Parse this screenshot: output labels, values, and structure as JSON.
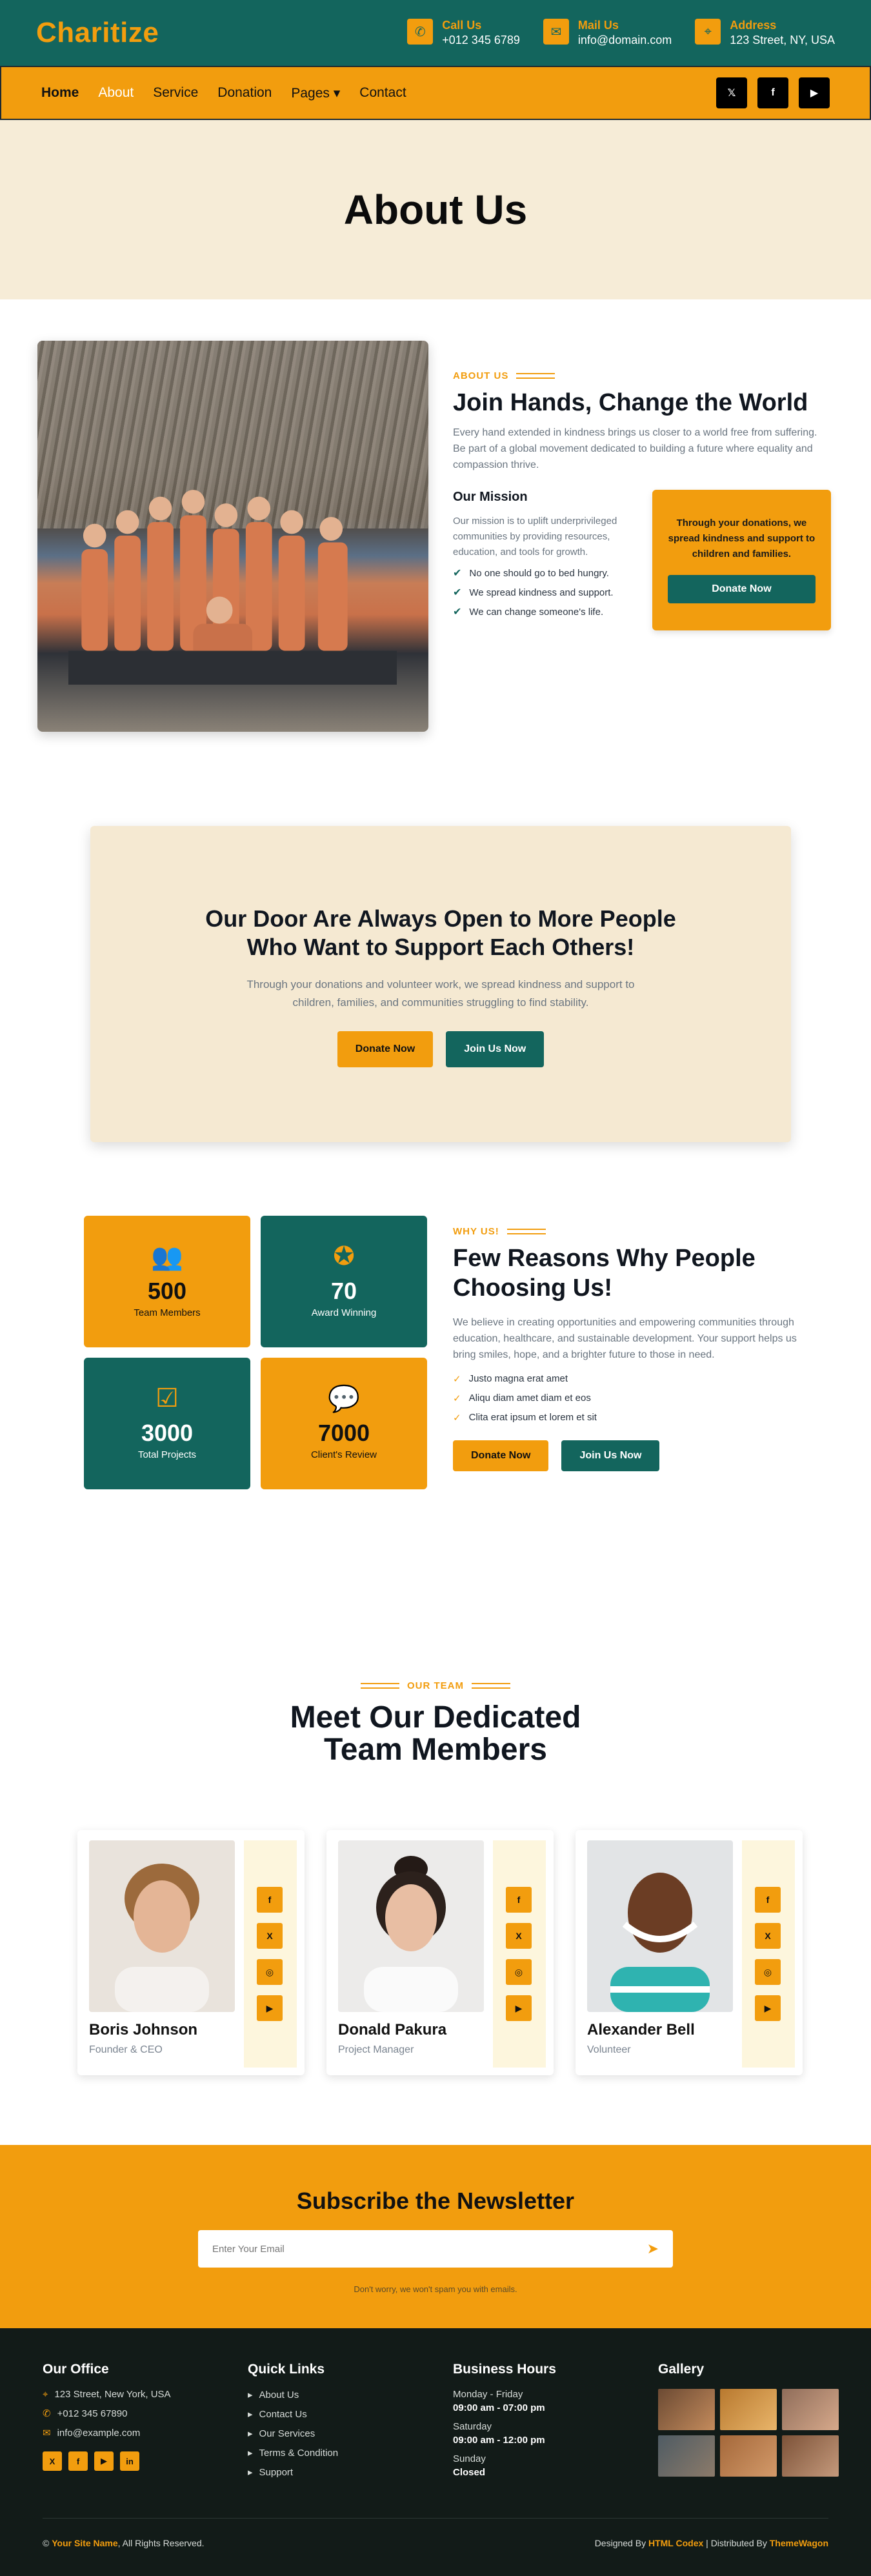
{
  "brand": {
    "logo": "Charitize"
  },
  "topbar": {
    "contacts": [
      {
        "label": "Call Us",
        "value": "+012 345 6789",
        "icon": "phone-icon"
      },
      {
        "label": "Mail Us",
        "value": "info@domain.com",
        "icon": "envelope-icon"
      },
      {
        "label": "Address",
        "value": "123 Street, NY, USA",
        "icon": "map-pin-icon"
      }
    ]
  },
  "nav": {
    "items": [
      "Home",
      "About",
      "Service",
      "Donation",
      "Pages",
      "Contact"
    ],
    "pages_caret": "▾",
    "social": [
      "twitter-icon",
      "facebook-icon",
      "youtube-icon"
    ]
  },
  "page_header": {
    "title": "About Us"
  },
  "about": {
    "eyebrow": "ABOUT US",
    "title": "Join Hands, Change the World",
    "lead": "Every hand extended in kindness brings us closer to a world free from suffering. Be part of a global movement dedicated to building a future where equality and compassion thrive.",
    "mission_title": "Our Mission",
    "mission_text": "Our mission is to uplift underprivileged communities by providing resources, education, and tools for growth.",
    "checks": [
      "No one should go to bed hungry.",
      "We spread kindness and support.",
      "We can change someone's life."
    ],
    "donate_text": "Through your donations, we spread kindness and support to children and families.",
    "donate_button": "Donate Now"
  },
  "door": {
    "title_line1": "Our Door Are Always Open to More People",
    "title_line2": "Who Want to Support Each Others!",
    "text": "Through your donations and volunteer work, we spread kindness and support to children, families, and communities struggling to find stability.",
    "donate_button": "Donate Now",
    "join_button": "Join Us Now"
  },
  "stats": [
    {
      "value": "500",
      "label": "Team Members",
      "icon": "users-icon"
    },
    {
      "value": "70",
      "label": "Award Winning",
      "icon": "award-icon"
    },
    {
      "value": "3000",
      "label": "Total Projects",
      "icon": "list-check-icon"
    },
    {
      "value": "7000",
      "label": "Client's Review",
      "icon": "comments-icon"
    }
  ],
  "reasons": {
    "eyebrow": "WHY US!",
    "title_line1": "Few Reasons Why People",
    "title_line2": "Choosing Us!",
    "lead": "We believe in creating opportunities and empowering communities through education, healthcare, and sustainable development. Your support helps us bring smiles, hope, and a brighter future to those in need.",
    "list": [
      "Justo magna erat amet",
      "Aliqu diam amet diam et eos",
      "Clita erat ipsum et lorem et sit"
    ],
    "donate_button": "Donate Now",
    "join_button": "Join Us Now"
  },
  "team": {
    "eyebrow": "OUR TEAM",
    "title_line1": "Meet Our Dedicated",
    "title_line2": "Team Members",
    "members": [
      {
        "name": "Boris Johnson",
        "role": "Founder & CEO"
      },
      {
        "name": "Donald Pakura",
        "role": "Project Manager"
      },
      {
        "name": "Alexander Bell",
        "role": "Volunteer"
      }
    ],
    "social_glyphs": [
      "f",
      "X",
      "◎",
      "▶"
    ]
  },
  "newsletter": {
    "title": "Subscribe the Newsletter",
    "placeholder": "Enter Your Email",
    "note": "Don't worry, we won't spam you with emails."
  },
  "footer": {
    "office_title": "Our Office",
    "office": [
      "123 Street, New York, USA",
      "+012 345 67890",
      "info@example.com"
    ],
    "office_social": [
      "X",
      "f",
      "▶",
      "in"
    ],
    "links_title": "Quick Links",
    "links": [
      "About Us",
      "Contact Us",
      "Our Services",
      "Terms & Condition",
      "Support"
    ],
    "hours_title": "Business Hours",
    "hours": [
      {
        "day": "Monday - Friday",
        "time": "09:00 am - 07:00 pm"
      },
      {
        "day": "Saturday",
        "time": "09:00 am - 12:00 pm"
      },
      {
        "day": "Sunday",
        "time": "Closed"
      }
    ],
    "gallery_title": "Gallery",
    "copyright_prefix": "©",
    "site_name": "Your Site Name",
    "rights": ", All Rights Reserved.",
    "designed_by": "Designed By",
    "designer": "HTML Codex",
    "distributed_by": "| Distributed By",
    "distributor": "ThemeWagon"
  }
}
